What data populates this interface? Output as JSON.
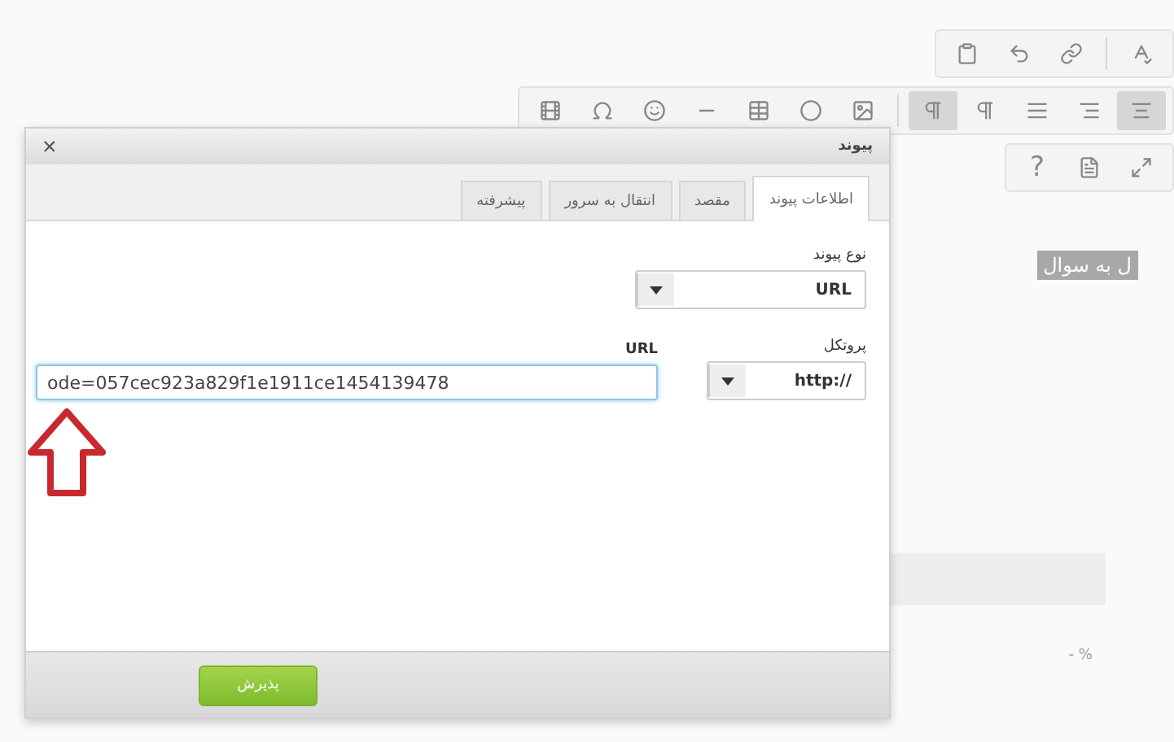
{
  "toolbar": {
    "rows": [
      [
        {
          "kind": "paste",
          "selected": false
        },
        {
          "kind": "undo",
          "selected": false
        },
        {
          "kind": "link",
          "selected": false
        },
        {
          "kind": "sep"
        },
        {
          "kind": "spellcheck",
          "selected": false
        }
      ],
      [
        {
          "kind": "video",
          "selected": false
        },
        {
          "kind": "omega",
          "selected": false
        },
        {
          "kind": "smiley",
          "selected": false
        },
        {
          "kind": "rule",
          "selected": false
        },
        {
          "kind": "table",
          "selected": false
        },
        {
          "kind": "circle",
          "selected": false
        },
        {
          "kind": "image",
          "selected": false
        },
        {
          "kind": "sep"
        },
        {
          "kind": "rtl",
          "selected": true
        },
        {
          "kind": "ltr",
          "selected": false
        },
        {
          "kind": "block",
          "selected": false
        },
        {
          "kind": "alignright",
          "selected": false
        },
        {
          "kind": "aligncenter",
          "selected": true
        }
      ],
      [
        {
          "kind": "help",
          "label": "?",
          "selected": false
        },
        {
          "kind": "doc",
          "selected": false
        },
        {
          "kind": "maximize",
          "selected": false
        }
      ]
    ]
  },
  "editor": {
    "highlighted_text": "ل به سوال",
    "cell_text": "- %"
  },
  "dialog": {
    "title": "پیوند",
    "close": "×",
    "tabs": [
      {
        "label": "اطلاعات پیوند",
        "selected": true
      },
      {
        "label": "مقصد",
        "selected": false
      },
      {
        "label": "انتقال به سرور",
        "selected": false
      },
      {
        "label": "پیشرفته",
        "selected": false
      }
    ],
    "link_type": {
      "label": "نوع پیوند",
      "value": "URL"
    },
    "protocol": {
      "label": "پروتکل",
      "value": "http://"
    },
    "url": {
      "label": "URL",
      "value": "ode=057cec923a829f1e1911ce1454139478"
    },
    "ok_button": "پذیرش"
  }
}
